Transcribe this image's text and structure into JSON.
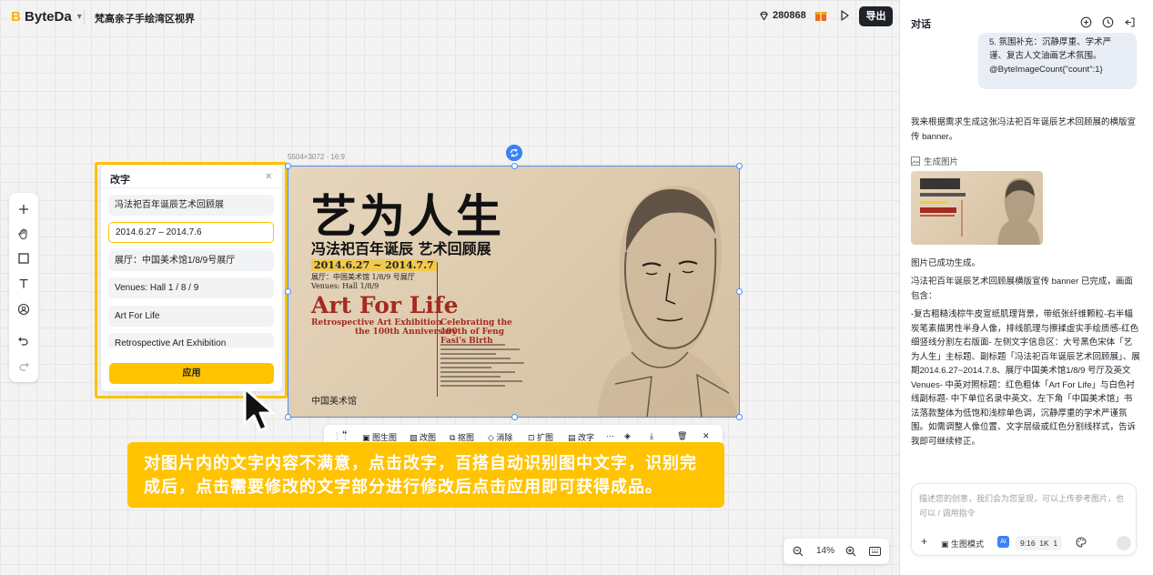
{
  "header": {
    "brand": "ByteDa",
    "project_title": "梵高亲子手绘湾区视界",
    "credits": "280868",
    "export_label": "导出"
  },
  "text_panel": {
    "title": "改字",
    "fields": [
      "冯法祀百年诞辰艺术回顾展",
      "2014.6.27 – 2014.7.6",
      "展厅：中国美术馆1/8/9号展厅",
      "Venues: Hall 1 / 8 / 9",
      "Art For Life",
      "Retrospective Art Exhibition"
    ],
    "active_index": 1,
    "apply_label": "应用"
  },
  "canvas": {
    "dimensions": "5504×3072 · 16:9",
    "poster": {
      "title": "艺为人生",
      "subtitle": "冯法祀百年诞辰 艺术回顾展",
      "date": "2014.6.27 ~ 2014.7.7",
      "venue_cn": "展厅：中国美术馆 1/8/9 号展厅",
      "venue_en": "Venues: Hall 1/8/9",
      "art_title": "Art For Life",
      "retro_line1": "Retrospective Art Exhibition",
      "retro_line2": "the 100th Anniversary",
      "celebrate": "Celebrating the 100th of Feng Fasi's Birth",
      "logo": "中国美术馆"
    }
  },
  "image_toolbar": {
    "items": [
      "图生图",
      "改图",
      "抠图",
      "消除",
      "扩图",
      "改字"
    ]
  },
  "caption": "对图片内的文字内容不满意，点击改字，百搭自动识别图中文字，识别完成后，点击需要修改的文字部分进行修改后点击应用即可获得成品。",
  "zoom": {
    "level": "14%"
  },
  "chat": {
    "title": "对话",
    "user_bubble": "5. 氛围补充：沉静厚重、学术严谨、复古人文油画艺术氛围。@ByteImageCount{\"count\":1}",
    "reply_intro": "我来根据需求生成这张冯法祀百年诞辰艺术回顾展的横版宣传 banner。",
    "gen_label": "生成图片",
    "done": "图片已成功生成。",
    "summary": "冯法祀百年诞辰艺术回顾展横版宣传 banner 已完成，画面包含：",
    "details": "-复古粗糙浅棕牛皮宣纸肌理背景，带纸张纤维颗粒-右半幅炭笔素描男性半身人像，排线肌理与擦揉虚实手绘质感-红色细竖线分割左右版面- 左侧文字信息区：大号黑色宋体「艺为人生」主标题、副标题「冯法祀百年诞辰艺术回顾展」、展期2014.6.27~2014.7.8、展厅中国美术馆1/8/9 号厅及英文Venues- 中英对照标题：红色粗体「Art For Life」与白色衬线副标题- 中下单位名录中英文、左下角「中国美术馆」书法落款整体为低饱和浅棕单色调，沉静厚重的学术严谨氛围。如需调整人像位置、文字层级或红色分割线样式，告诉我即可继续修正。",
    "input_placeholder": "描述您的创意，我们会为您呈现，可以上传参考图片，也可以 / 调用指令",
    "mode_label": "生图模式",
    "ratio": "9:16",
    "resolution": "1K",
    "count": "1"
  }
}
